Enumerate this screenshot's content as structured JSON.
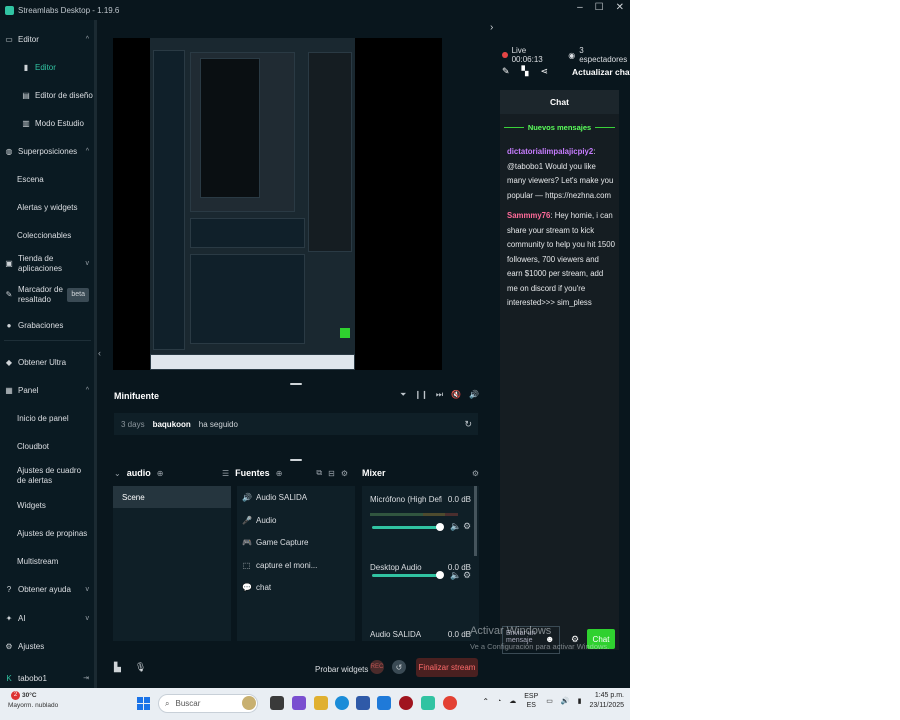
{
  "window": {
    "title": "Streamlabs Desktop - 1.19.6",
    "controls": [
      "–",
      "☐",
      "✕"
    ]
  },
  "sidebar": {
    "items": [
      {
        "label": "Editor",
        "icon": "editor-icon",
        "chev": "^"
      },
      {
        "label": "Editor",
        "icon": "editor-icon",
        "active": true
      },
      {
        "label": "Editor de diseño",
        "icon": "layout-icon"
      },
      {
        "label": "Modo Estudio",
        "icon": "studio-icon"
      },
      {
        "label": "Superposiciones",
        "icon": "overlays-icon",
        "chev": "^"
      },
      {
        "label": "Escena"
      },
      {
        "label": "Alertas y widgets"
      },
      {
        "label": "Coleccionables"
      },
      {
        "label": "Tienda de aplicaciones",
        "icon": "store-icon",
        "chev": "v"
      },
      {
        "label": "Marcador de resaltado",
        "icon": "highlighter-icon",
        "badge": "beta"
      },
      {
        "label": "Grabaciones",
        "icon": "recordings-icon"
      },
      {
        "label": "Obtener Ultra",
        "icon": "ultra-icon"
      },
      {
        "label": "Panel",
        "icon": "dashboard-icon",
        "chev": "^"
      },
      {
        "label": "Inicio de panel"
      },
      {
        "label": "Cloudbot"
      },
      {
        "label": "Ajustes de cuadro de alertas"
      },
      {
        "label": "Widgets"
      },
      {
        "label": "Ajustes de propinas"
      },
      {
        "label": "Multistream"
      },
      {
        "label": "Obtener ayuda",
        "icon": "help-icon",
        "chev": "v"
      },
      {
        "label": "AI",
        "icon": "ai-icon",
        "chev": "v"
      },
      {
        "label": "Ajustes",
        "icon": "settings-icon"
      },
      {
        "label": "tabobo1",
        "icon": "user-icon",
        "logout": "⇥"
      }
    ]
  },
  "minifeed": {
    "title": "Minifuente",
    "tools": [
      "⏷",
      "❙❙",
      "⏭",
      "🔇",
      "🔊"
    ],
    "row": {
      "days": "3 days",
      "user": "baqukoon",
      "action": "ha seguido",
      "refresh": "↻"
    }
  },
  "scenes": {
    "title": "audio",
    "items": [
      "Scene"
    ]
  },
  "sources": {
    "title": "Fuentes",
    "items": [
      {
        "label": "Audio SALIDA",
        "icon": "speaker-icon",
        "glyph": "🔊"
      },
      {
        "label": "Audio",
        "icon": "microphone-icon",
        "glyph": "🎤"
      },
      {
        "label": "Game Capture",
        "icon": "gamepad-icon",
        "glyph": "🎮"
      },
      {
        "label": "capture el moni...",
        "icon": "monitor-capture-icon",
        "glyph": "⬚"
      },
      {
        "label": "chat",
        "icon": "chat-icon",
        "glyph": "💬"
      }
    ]
  },
  "mixer": {
    "title": "Mixer",
    "channels": [
      {
        "name": "Micrófono (High Defi...",
        "db": "0.0 dB"
      },
      {
        "name": "Desktop Audio",
        "db": "0.0 dB"
      },
      {
        "name": "Audio SALIDA",
        "db": "0.0 dB"
      }
    ]
  },
  "bottombar": {
    "test_widgets": "Probar widgets",
    "rec": "REC",
    "end_stream": "Finalizar stream"
  },
  "stream": {
    "status": "Live 00:06:13",
    "viewers": "3 espectadores",
    "update_chat": "Actualizar chat"
  },
  "chat": {
    "title": "Chat",
    "new_messages": "Nuevos mensajes",
    "messages": [
      {
        "author": "dictatorialimpalajicpiy2",
        "author_color": "#c77dff",
        "text": "@tabobo1 Would you like many viewers? Let's make you popular — https://nezhna.com"
      },
      {
        "author": "Sammmy76",
        "author_color": "#ff6b9a",
        "text": "Hey homie, i can share your stream to kick community to help you hit 1500 followers, 700 viewers and earn $1000 per stream, add me on discord if you're interested>>> sim_pless"
      }
    ],
    "input_placeholder": "un mensaje",
    "input_prefix": "Enviar",
    "send_label": "Chat"
  },
  "watermark": {
    "line1": "Activar Windows",
    "line2": "Ve a Configuración para activar Windows."
  },
  "taskbar": {
    "weather_temp": "30°C",
    "weather_desc": "Mayorm. nublado",
    "notif_count": "2",
    "search_placeholder": "Buscar",
    "lang_top": "ESP",
    "lang_bottom": "ES",
    "time": "1:45 p.m.",
    "date": "23/11/2025"
  },
  "colors": {
    "accent": "#31c3a2",
    "live": "#e64545",
    "chat_green": "#2fd12f",
    "end_stream": "#ff6b6b"
  }
}
